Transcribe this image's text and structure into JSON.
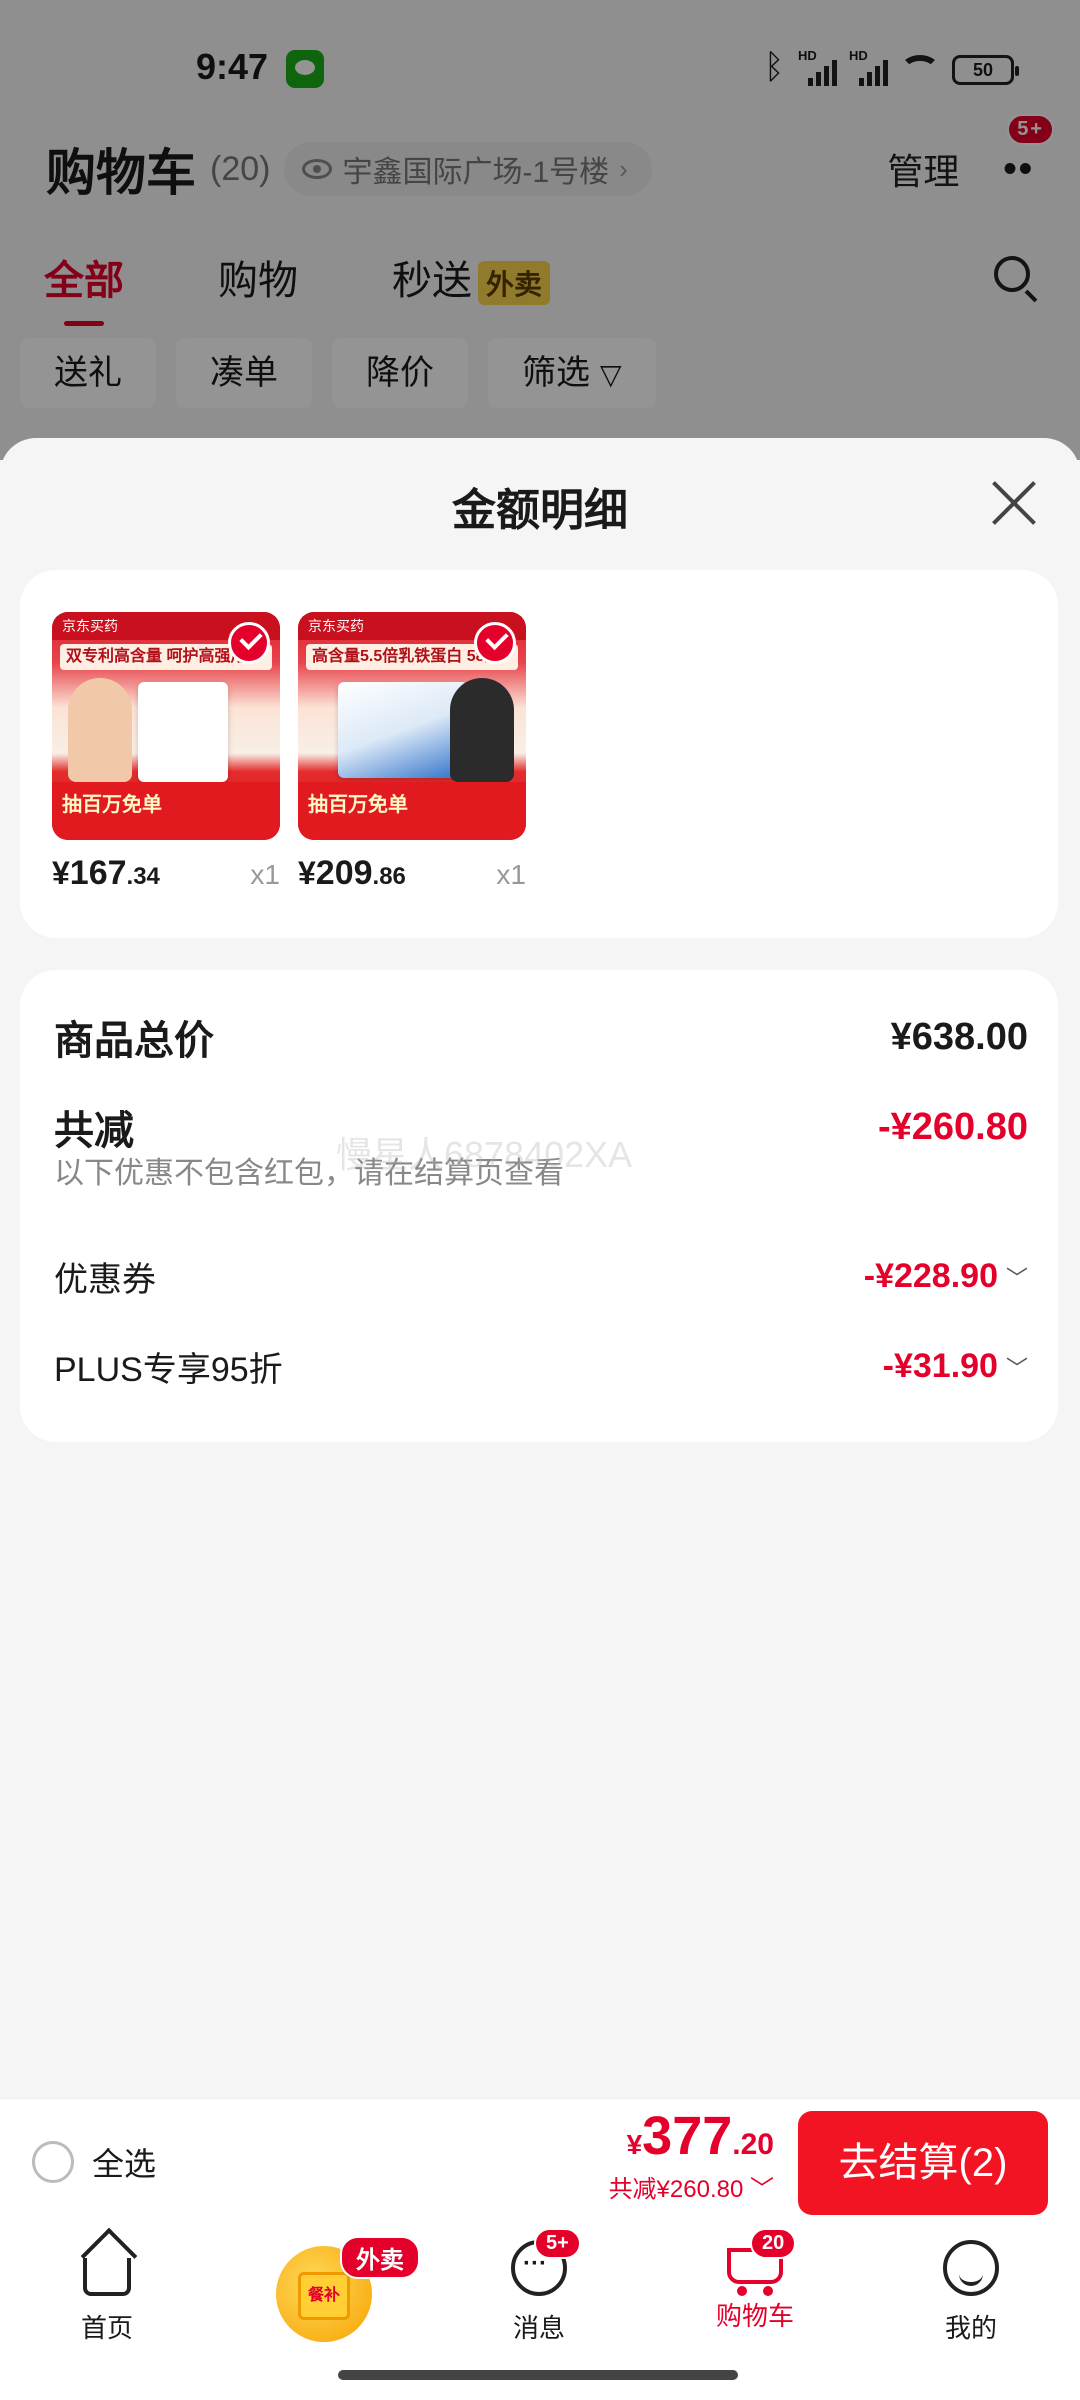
{
  "status_bar": {
    "time": "9:47",
    "battery": "50",
    "signal_label": "HD"
  },
  "header": {
    "title": "购物车",
    "count": "(20)",
    "address": "宇鑫国际广场-1号楼",
    "manage": "管理",
    "more_badge": "5+"
  },
  "tabs": [
    {
      "label": "全部",
      "active": true
    },
    {
      "label": "购物",
      "active": false
    },
    {
      "label": "秒送",
      "tag": "外卖",
      "active": false
    }
  ],
  "chips": [
    "送礼",
    "凑单",
    "降价",
    "筛选"
  ],
  "sheet": {
    "title": "金额明细",
    "products": [
      {
        "img_top": "京东买药",
        "img_slogan": "双专利高含量 呵护高强用",
        "img_bottom": "抽百万免单",
        "price_int": "167",
        "price_dec": ".34",
        "qty": "x1"
      },
      {
        "img_top": "京东买药",
        "img_slogan": "高含量5.5倍乳铁蛋白 58重",
        "img_bottom": "抽百万免单",
        "price_int": "209",
        "price_dec": ".86",
        "qty": "x1"
      }
    ],
    "summary": {
      "total_label": "商品总价",
      "total_value": "¥638.00",
      "reduce_label": "共减",
      "reduce_value": "-¥260.80",
      "note": "以下优惠不包含红包，请在结算页查看",
      "coupon_label": "优惠券",
      "coupon_value": "-¥228.90",
      "plus_label": "PLUS专享95折",
      "plus_value": "-¥31.90"
    }
  },
  "watermark": "慢星人6878402XA",
  "checkout": {
    "select_all": "全选",
    "yen": "¥",
    "price_int": "377",
    "price_dec": ".20",
    "saved": "共减¥260.80",
    "button": "去结算(2)"
  },
  "nav": {
    "home": "首页",
    "food_label": "餐补",
    "food_badge": "外卖",
    "messages": "消息",
    "messages_badge": "5+",
    "cart": "购物车",
    "cart_badge": "20",
    "mine": "我的"
  },
  "colors": {
    "accent": "#e4002b",
    "checkout_button": "#f31423",
    "tag_yellow": "#f9d44c"
  }
}
